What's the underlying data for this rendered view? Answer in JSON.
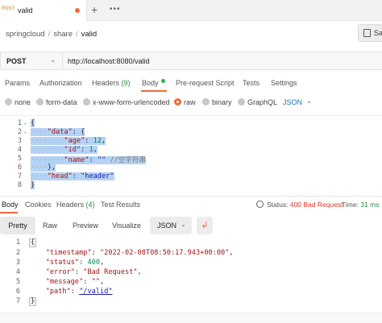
{
  "tab": {
    "method": "POST",
    "name": "valid"
  },
  "breadcrumb": {
    "part1": "springcloud",
    "part2": "share",
    "current": "valid"
  },
  "save_label": "Save",
  "request": {
    "method": "POST",
    "url": "http://localhost:8080/valid"
  },
  "req_tabs": {
    "params": "Params",
    "authorization": "Authorization",
    "headers": "Headers",
    "headers_count": "(9)",
    "body": "Body",
    "prerequest": "Pre-request Script",
    "tests": "Tests",
    "settings": "Settings"
  },
  "body_types": {
    "none": "none",
    "form_data": "form-data",
    "urlencoded": "x-www-form-urlencoded",
    "raw": "raw",
    "binary": "binary",
    "graphql": "GraphQL",
    "format": "JSON"
  },
  "request_body": {
    "line_numbers": [
      "1",
      "2",
      "3",
      "4",
      "5",
      "6",
      "7",
      "8"
    ],
    "open_brace": "{",
    "data_key": "\"data\"",
    "age_key": "\"age\"",
    "age_val": "12",
    "id_key": "\"id\"",
    "id_val": "1",
    "name_key": "\"name\"",
    "name_val": "\"\"",
    "name_comment": "//空字符串",
    "inner_close": "},",
    "head_key": "\"head\"",
    "head_val": "\"header\"",
    "close_brace": "}"
  },
  "resp_tabs": {
    "body": "Body",
    "cookies": "Cookies",
    "headers": "Headers",
    "headers_count": "(4)",
    "test_results": "Test Results"
  },
  "status": {
    "label": "Status:",
    "value": "400 Bad Request",
    "time_label": "Time:",
    "time_value": "31 ms"
  },
  "view_tabs": {
    "pretty": "Pretty",
    "raw": "Raw",
    "preview": "Preview",
    "visualize": "Visualize",
    "format": "JSON"
  },
  "response_body": {
    "line_numbers": [
      "1",
      "2",
      "3",
      "4",
      "5",
      "6",
      "7"
    ],
    "open_brace": "{",
    "timestamp_key": "\"timestamp\"",
    "timestamp_val": "\"2022-02-08T08:50:17.943+00:00\"",
    "status_key": "\"status\"",
    "status_val": "400",
    "error_key": "\"error\"",
    "error_val": "\"Bad Request\"",
    "message_key": "\"message\"",
    "message_val": "\"\"",
    "path_key": "\"path\"",
    "path_val": "\"/valid\"",
    "close_brace": "}"
  },
  "colors": {
    "accent": "#f26b3a",
    "active_dot": "#2cb24b",
    "status_error": "#d9382b",
    "time_ok": "#2b8a3e",
    "selection": "#b4d2f5"
  }
}
